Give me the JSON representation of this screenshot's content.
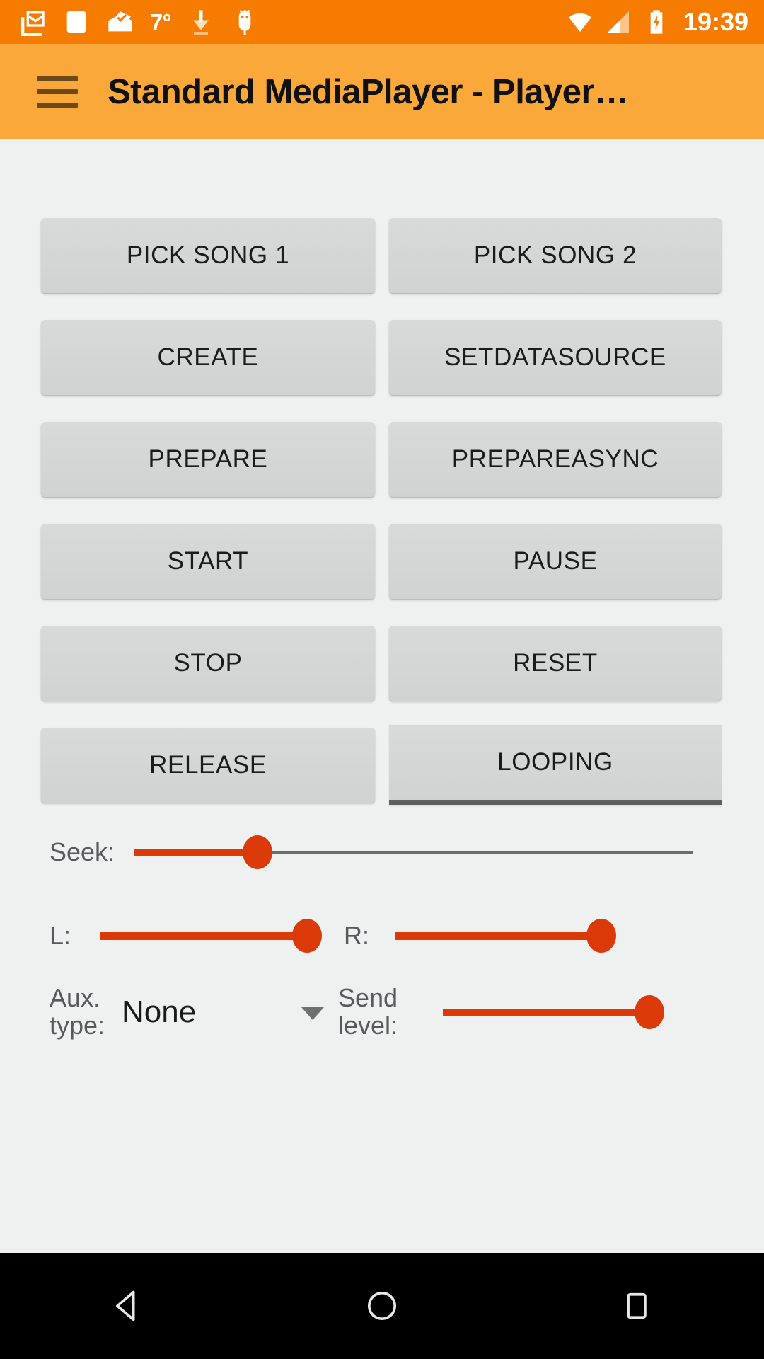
{
  "statusbar": {
    "temperature": "7°",
    "time": "19:39",
    "left_icons": [
      "gmail-icon",
      "white-square-icon",
      "inbox-check-icon",
      "temperature-text",
      "download-arrow-icon",
      "android-bug-icon"
    ],
    "right_icons": [
      "wifi-icon",
      "cell-signal-icon",
      "battery-charging-icon"
    ],
    "background_color": "#F57C00"
  },
  "appbar": {
    "menu_icon": "hamburger-menu-icon",
    "title": "Standard MediaPlayer - Player…",
    "background_color": "#F9A839"
  },
  "buttons": {
    "rows": [
      {
        "left": "PICK SONG 1",
        "right": "PICK SONG 2"
      },
      {
        "left": "CREATE",
        "right": "SETDATASOURCE"
      },
      {
        "left": "PREPARE",
        "right": "PREPAREASYNC"
      },
      {
        "left": "START",
        "right": "PAUSE"
      },
      {
        "left": "STOP",
        "right": "RESET"
      },
      {
        "left": "RELEASE",
        "right": "LOOPING"
      }
    ],
    "face_color": "#d4d6d6",
    "focused_underline_color": "#5e5e5e"
  },
  "controls": {
    "seek": {
      "label": "Seek:",
      "value_percent": 22
    },
    "left_volume": {
      "label": "L:",
      "value_percent": 100
    },
    "right_volume": {
      "label": "R:",
      "value_percent": 100
    },
    "aux": {
      "label": "Aux.\ntype:",
      "selected": "None",
      "caret_icon": "chevron-down-icon"
    },
    "send_level": {
      "label": "Send\nlevel:",
      "value_percent": 100
    },
    "accent_color": "#DB3907",
    "track_color": "#6d6d6d"
  },
  "navbar": {
    "back": "back-triangle-icon",
    "home": "home-circle-icon",
    "recents": "recents-square-icon",
    "background_color": "#000000"
  }
}
